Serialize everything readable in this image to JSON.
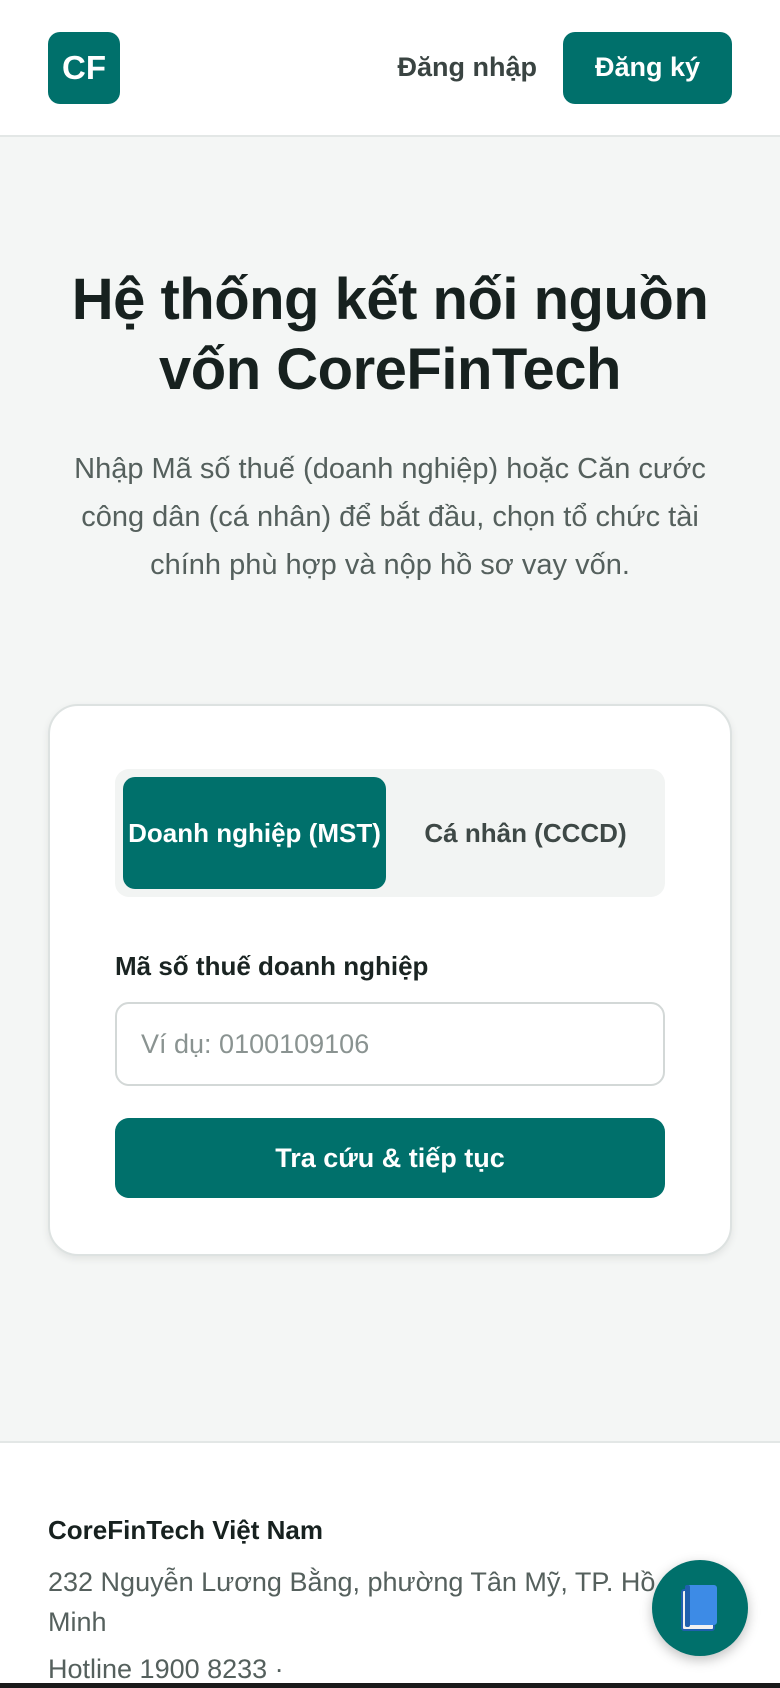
{
  "header": {
    "logo_text": "CF",
    "login_label": "Đăng nhập",
    "register_label": "Đăng ký"
  },
  "hero": {
    "title": "Hệ thống kết nối nguồn vốn CoreFinTech",
    "subtitle": "Nhập Mã số thuế (doanh nghiệp) hoặc Căn cước công dân (cá nhân) để bắt đầu, chọn tổ chức tài chính phù hợp và nộp hồ sơ vay vốn."
  },
  "lookup_form": {
    "tabs": [
      {
        "label": "Doanh nghiệp (MST)",
        "active": true
      },
      {
        "label": "Cá nhân (CCCD)",
        "active": false
      }
    ],
    "field_label": "Mã số thuế doanh nghiệp",
    "input_value": "",
    "input_placeholder": "Ví dụ: 0100109106",
    "submit_label": "Tra cứu & tiếp tục"
  },
  "footer": {
    "company": "CoreFinTech Việt Nam",
    "address": "232 Nguyễn Lương Bằng, phường Tân Mỹ, TP. Hồ Chí Minh",
    "hotline": "Hotline 1900 8233 ·"
  },
  "fab": {
    "icon": "book-icon"
  },
  "colors": {
    "brand": "#00706b",
    "page_bg": "#f4f6f5",
    "text_dark": "#17211f",
    "text_muted": "#55605d"
  }
}
